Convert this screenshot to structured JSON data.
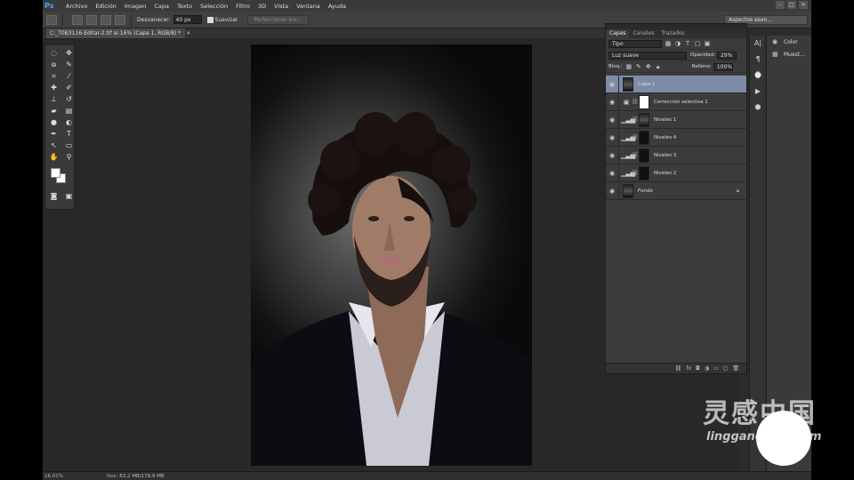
{
  "app": {
    "logo": "Ps",
    "menu": [
      "Archivo",
      "Edición",
      "Imagen",
      "Capa",
      "Texto",
      "Selección",
      "Filtro",
      "3D",
      "Vista",
      "Ventana",
      "Ayuda"
    ],
    "window_controls": [
      "–",
      "□",
      "×"
    ]
  },
  "options_bar": {
    "feather_label": "Desvanecer:",
    "feather_value": "40 px",
    "antialias_label": "Suavizar",
    "refine_button": "Perfeccionar bor...",
    "workspace": "Aspectos esen..."
  },
  "document": {
    "tab_title": "C:_T0B3116-Editar-2.tif al 16% (Capa 1, RGB/8) *",
    "tab_close": "×"
  },
  "status": {
    "zoom": "16,01%",
    "doc_info": "Doc: 63,2 MB/178,9 MB"
  },
  "layers_panel": {
    "tabs": [
      "Capas",
      "Canales",
      "Trazados"
    ],
    "filter_kind": "Tipo",
    "blend_mode": "Luz suave",
    "opacity_label": "Opacidad:",
    "opacity_value": "29%",
    "lock_label": "Bloq.:",
    "fill_label": "Relleno:",
    "fill_value": "100%",
    "layers": [
      {
        "name": "Capa 1",
        "active": true
      },
      {
        "name": "Corrección selectiva 1",
        "active": false
      },
      {
        "name": "Niveles 1",
        "active": false
      },
      {
        "name": "Niveles 4",
        "active": false
      },
      {
        "name": "Niveles 3",
        "active": false
      },
      {
        "name": "Niveles 2",
        "active": false
      },
      {
        "name": "Fondo",
        "active": false
      }
    ],
    "footer_icons": [
      "link-icon",
      "fx-icon",
      "mask-icon",
      "adjustment-icon",
      "group-icon",
      "new-layer-icon",
      "trash-icon"
    ]
  },
  "side_panel": {
    "items": [
      "Color",
      "Muest..."
    ]
  },
  "watermark": {
    "brand": "灵感中国",
    "url": "lingganchina.com"
  }
}
